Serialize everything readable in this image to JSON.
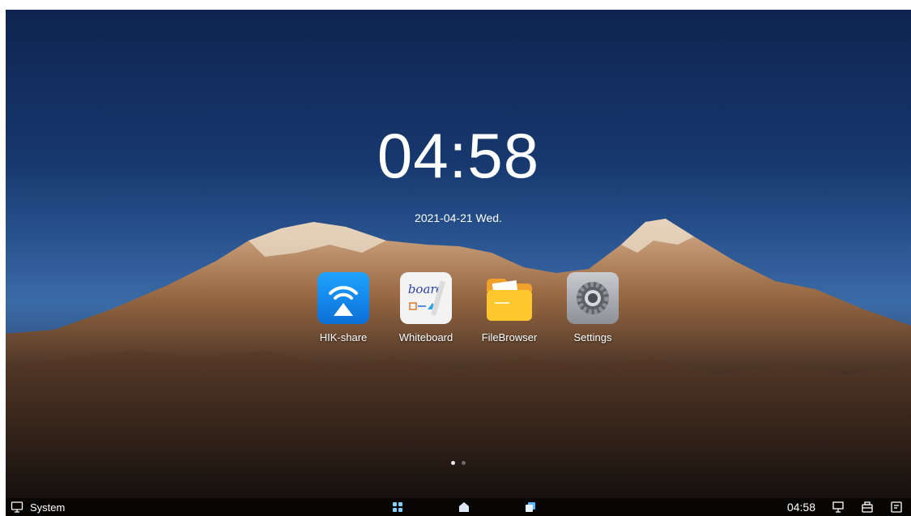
{
  "clock": {
    "time": "04:58",
    "date": "2021-04-21  Wed."
  },
  "apps": [
    {
      "label": "HIK-share",
      "icon": "hik-share-icon"
    },
    {
      "label": "Whiteboard",
      "icon": "whiteboard-icon",
      "icon_text": "board"
    },
    {
      "label": "FileBrowser",
      "icon": "folder-icon"
    },
    {
      "label": "Settings",
      "icon": "gear-icon"
    }
  ],
  "pager": {
    "pages": 2,
    "current": 1
  },
  "taskbar": {
    "system_label": "System",
    "time": "04:58",
    "center_buttons": [
      "apps-grid-icon",
      "home-icon",
      "recent-apps-icon"
    ],
    "right_icons": [
      "screen-share-icon",
      "toolbox-icon",
      "notes-icon"
    ]
  }
}
